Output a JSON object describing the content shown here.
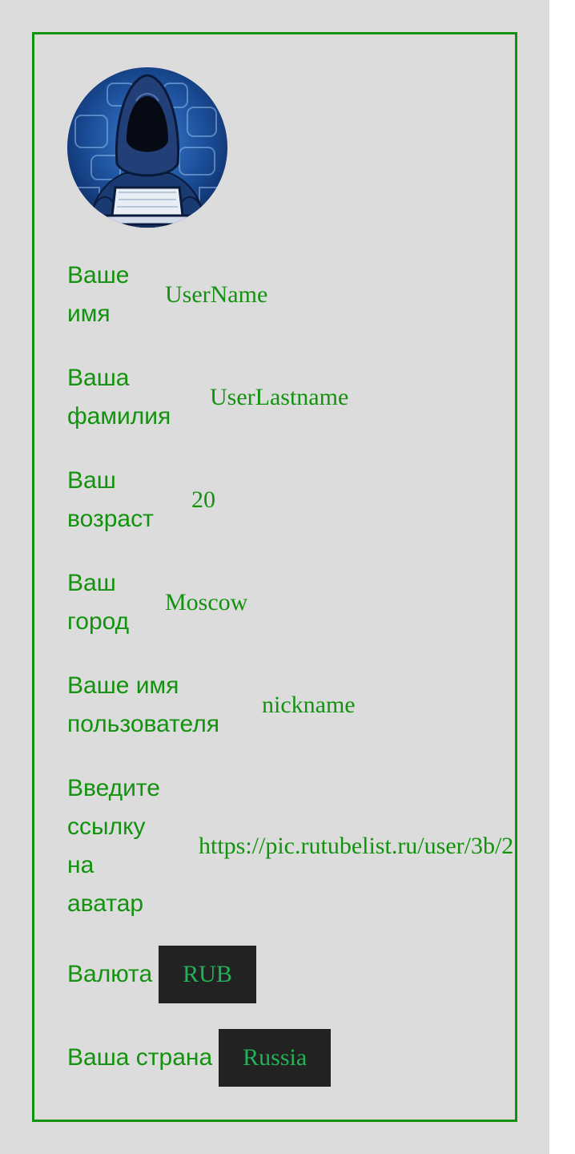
{
  "profile": {
    "avatar_icon": "hacker-avatar-icon",
    "fields": [
      {
        "label": "Ваше имя",
        "value": "UserName"
      },
      {
        "label": "Ваша фамилия",
        "value": "UserLastname"
      },
      {
        "label": "Ваш возраст",
        "value": "20"
      },
      {
        "label": "Ваш город",
        "value": "Moscow"
      },
      {
        "label": "Ваше имя пользователя",
        "value": "nickname"
      },
      {
        "label": "Введите ссылку на аватар",
        "value": "https://pic.rutubelist.ru/user/3b/2"
      }
    ],
    "currency": {
      "label": "Валюта",
      "value": "RUB"
    },
    "country": {
      "label": "Ваша страна",
      "value": "Russia"
    }
  },
  "colors": {
    "text": "#13920f",
    "border": "#13920f",
    "background": "#dcdcdc",
    "select_background": "#222222",
    "select_text": "#1fb556"
  }
}
